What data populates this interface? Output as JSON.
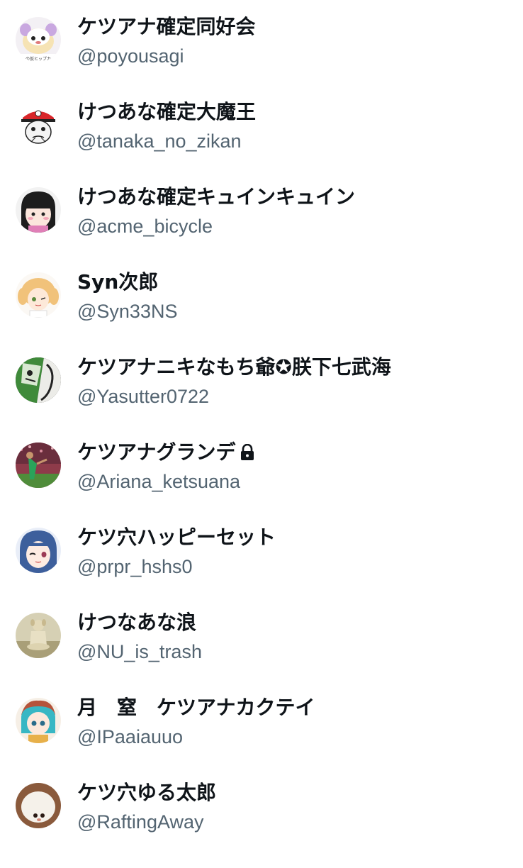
{
  "users": [
    {
      "display_name": "ケツアナ確定同好会",
      "handle": "@poyousagi",
      "avatar": "hamster-cartoon",
      "avatar_caption": "の仮ヒップカ"
    },
    {
      "display_name": "けつあな確定大魔王",
      "handle": "@tanaka_no_zikan",
      "avatar": "capped-sketch-face"
    },
    {
      "display_name": "けつあな確定キュインキュイン",
      "handle": "@acme_bicycle",
      "avatar": "bob-hair-girl"
    },
    {
      "display_name": "Syn次郎",
      "handle": "@Syn33NS",
      "avatar": "blonde-anime-girl"
    },
    {
      "display_name": "ケツアナニキなもち爺✪朕下七武海",
      "handle": "@Yasutter0722",
      "avatar": "green-manga-panel"
    },
    {
      "display_name": "ケツアナグランデ",
      "handle": "@Ariana_ketsuana",
      "avatar": "stadium-player",
      "locked": true
    },
    {
      "display_name": "ケツ穴ハッピーセット",
      "handle": "@prpr_hshs0",
      "avatar": "winking-anime-girl"
    },
    {
      "display_name": "けつなあな浪",
      "handle": "@NU_is_trash",
      "avatar": "meditating-dog"
    },
    {
      "display_name": "月　窒　ケツアナカクテイ",
      "handle": "@IPaaiauuo",
      "avatar": "teal-hair-anime"
    },
    {
      "display_name": "ケツ穴ゆる太郎",
      "handle": "@RaftingAway",
      "avatar": "white-mochi-creature"
    }
  ],
  "colors": {
    "name": "#0f1419",
    "handle": "#536471",
    "background": "#ffffff"
  },
  "lock_icon": "lock-icon"
}
